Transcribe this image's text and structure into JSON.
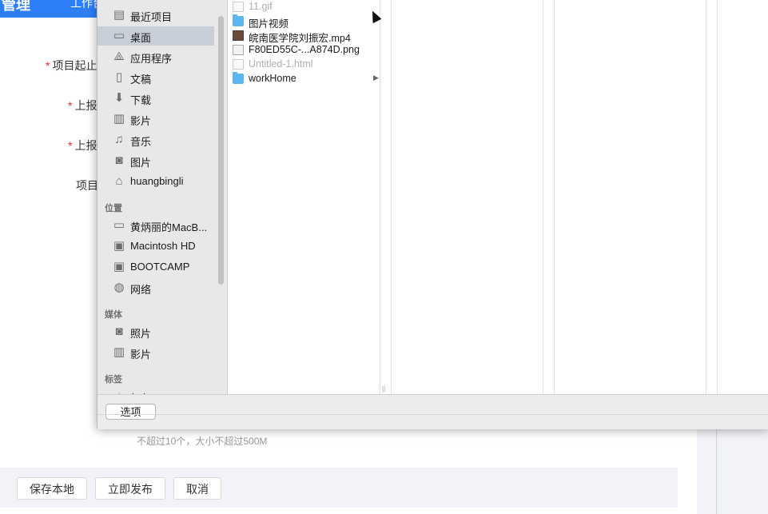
{
  "app": {
    "brand": "管理",
    "nav_label": "工作台"
  },
  "form": {
    "labels": [
      {
        "text": "项目起止",
        "required": true
      },
      {
        "text": "上报",
        "required": true
      },
      {
        "text": "上报",
        "required": true
      },
      {
        "text": "项目",
        "required": false
      }
    ],
    "upload_hint": "不超过10个，大小不超过500M",
    "actions": {
      "save_local": "保存本地",
      "publish_now": "立即发布",
      "cancel": "取消"
    }
  },
  "dialog": {
    "sidebar": {
      "favorites": [
        {
          "label": "最近项目",
          "icon": "recents-icon"
        },
        {
          "label": "桌面",
          "icon": "desktop-icon",
          "selected": true
        },
        {
          "label": "应用程序",
          "icon": "applications-icon"
        },
        {
          "label": "文稿",
          "icon": "documents-icon"
        },
        {
          "label": "下载",
          "icon": "downloads-icon"
        },
        {
          "label": "影片",
          "icon": "movies-icon"
        },
        {
          "label": "音乐",
          "icon": "music-icon"
        },
        {
          "label": "图片",
          "icon": "pictures-icon"
        },
        {
          "label": "huangbingli",
          "icon": "home-icon"
        }
      ],
      "locations_title": "位置",
      "locations": [
        {
          "label": "黄炳丽的MacB...",
          "icon": "laptop-icon"
        },
        {
          "label": "Macintosh HD",
          "icon": "disk-icon"
        },
        {
          "label": "BOOTCAMP",
          "icon": "disk-icon"
        },
        {
          "label": "网络",
          "icon": "network-icon"
        }
      ],
      "media_title": "媒体",
      "media": [
        {
          "label": "照片",
          "icon": "photos-icon"
        },
        {
          "label": "影片",
          "icon": "movies-icon"
        }
      ],
      "tags_title": "标签",
      "tags": [
        {
          "label": "红色",
          "icon": "red-tag-icon",
          "color": "#f04a3e"
        }
      ]
    },
    "files": [
      {
        "name": "11.gif",
        "type": "gif",
        "dim": true
      },
      {
        "name": "图片视频",
        "type": "folder",
        "has_children": true
      },
      {
        "name": "皖南医学院刘振宏.mp4",
        "type": "video"
      },
      {
        "name": "F80ED55C-...A874D.png",
        "type": "png"
      },
      {
        "name": "Untitled-1.html",
        "type": "html",
        "dim": true
      },
      {
        "name": "workHome",
        "type": "folder",
        "has_children": true
      }
    ],
    "options_button": "选项",
    "colors": {
      "sidebar_bg": "#e8e8e8",
      "selected_bg": "#c9cfd8",
      "folder": "#5cb7f0",
      "topbar": "#2d7ff9"
    }
  }
}
